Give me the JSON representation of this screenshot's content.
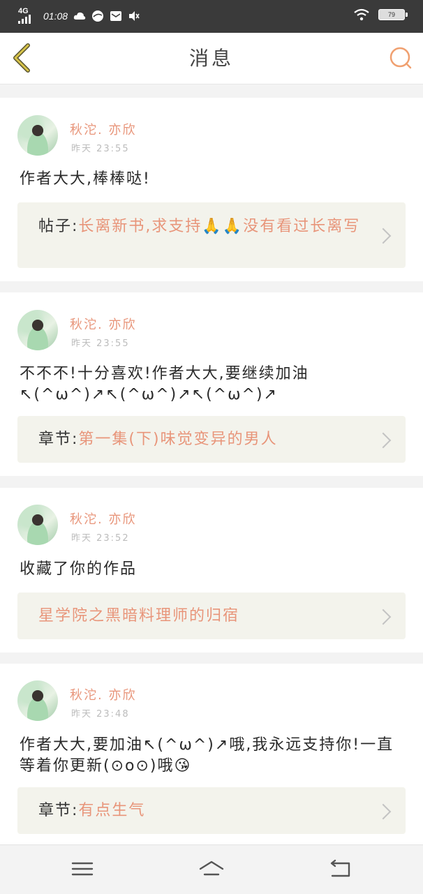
{
  "status_bar": {
    "network": "4G",
    "time": "01:08",
    "battery": "79",
    "icons": [
      "cloud-icon",
      "compass-icon",
      "mail-icon",
      "mute-icon",
      "wifi-icon",
      "battery-icon"
    ]
  },
  "header": {
    "title": "消息",
    "back_icon": "chevron-left-icon",
    "search_icon": "search-icon"
  },
  "messages": [
    {
      "username": "秋沱. 亦欣",
      "time": "昨天 23:55",
      "content": "作者大大,棒棒哒!",
      "quote_prefix": "帖子:",
      "quote_text": "长离新书,求支持🙏🙏没有看过长离写"
    },
    {
      "username": "秋沱. 亦欣",
      "time": "昨天 23:55",
      "content": "不不不!十分喜欢!作者大大,要继续加油↖(^ω^)↗↖(^ω^)↗↖(^ω^)↗",
      "quote_prefix": "章节:",
      "quote_text": "第一集(下)味觉变异的男人"
    },
    {
      "username": "秋沱. 亦欣",
      "time": "昨天 23:52",
      "content": "收藏了你的作品",
      "quote_prefix": "",
      "quote_text": "星学院之黑暗料理师的归宿"
    },
    {
      "username": "秋沱. 亦欣",
      "time": "昨天 23:48",
      "content": "作者大大,要加油↖(^ω^)↗哦,我永远支持你!一直等着你更新(⊙o⊙)哦😘",
      "quote_prefix": "章节:",
      "quote_text": "有点生气"
    }
  ],
  "bottom_nav": {
    "icons": [
      "menu-icon",
      "home-icon",
      "back-icon"
    ]
  },
  "colors": {
    "accent": "#e8957a",
    "status_bar": "#3a3a3a",
    "quote_bg": "#f3f3ec",
    "back_icon": "#c8b43c"
  }
}
